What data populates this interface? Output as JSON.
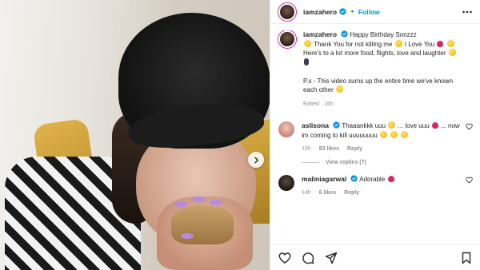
{
  "post": {
    "username": "iamzahero",
    "follow_label": "Follow",
    "separator": "•"
  },
  "caption": {
    "username": "iamzahero",
    "text_1": "Happy Birthday Sonzzz",
    "text_2": "Thank You for not killing me",
    "text_3": "I Love You",
    "text_4": "Here's to a lot more food, flights, love and laughter",
    "text_5": "P.s - This video sums up the entire time we've known each other",
    "meta": "Edited · 16h"
  },
  "comments": [
    {
      "username": "aslisona",
      "text_1": "Thaaankkk uuu",
      "text_2": "... love uuu",
      "text_3": "... now im coming to kill uuuuuuuu",
      "time": "15h",
      "likes": "83 likes",
      "reply": "Reply",
      "view_replies": "View replies (7)"
    },
    {
      "username": "maliniagarwal",
      "text_1": "Adorable",
      "time": "14h",
      "likes": "6 likes",
      "reply": "Reply"
    }
  ],
  "icons": {
    "like": "heart-icon",
    "comment": "comment-icon",
    "share": "share-icon",
    "save": "bookmark-icon",
    "more": "more-icon",
    "next": "chevron-right-icon",
    "verified": "verified-icon"
  },
  "colors": {
    "follow": "#0095f6",
    "verified": "#0095f6",
    "heart": "#e0245e",
    "muted": "#8e8e8e"
  }
}
